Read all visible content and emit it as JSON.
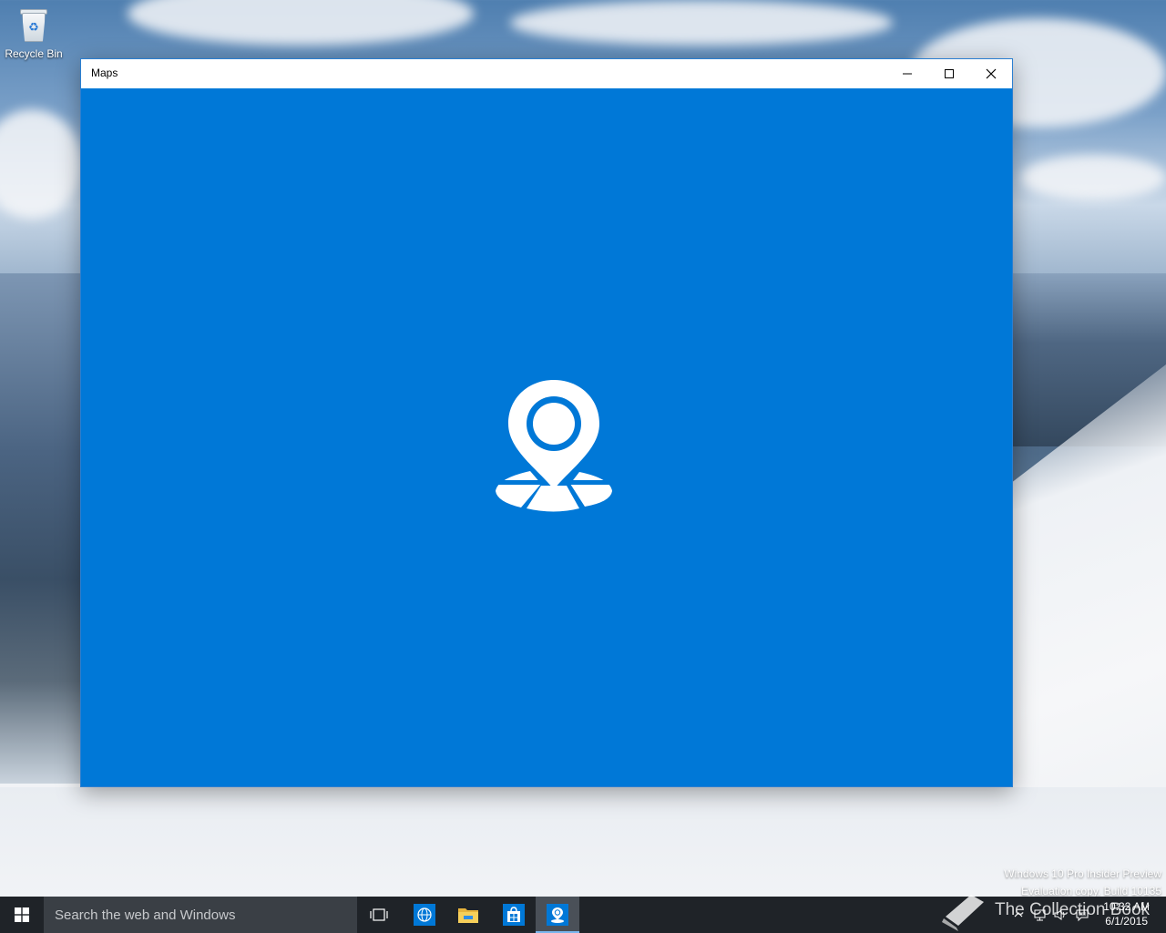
{
  "desktop": {
    "icons": [
      {
        "label": "Recycle Bin",
        "icon": "recycle-bin-icon"
      }
    ],
    "watermark": {
      "line1": "Windows 10 Pro Insider Preview",
      "line2": "Evaluation copy. Build 10135"
    }
  },
  "window": {
    "title": "Maps",
    "controls": {
      "minimize": "minimize-icon",
      "maximize": "maximize-icon",
      "close": "close-icon"
    },
    "splash_color": "#0078d7",
    "splash_icon": "maps-pin-icon"
  },
  "taskbar": {
    "search_placeholder": "Search the web and Windows",
    "pinned": [
      {
        "name": "task-view",
        "icon": "task-view-icon"
      },
      {
        "name": "edge",
        "icon": "globe-icon"
      },
      {
        "name": "file-explorer",
        "icon": "folder-icon"
      },
      {
        "name": "store",
        "icon": "store-icon"
      },
      {
        "name": "maps",
        "icon": "maps-icon",
        "active": true
      }
    ],
    "tray": {
      "time": "10:32 AM",
      "date": "6/1/2015"
    }
  },
  "overlay_logo": {
    "text": "The Collection Book"
  },
  "colors": {
    "accent": "#0078d7",
    "taskbar": "#1f2328",
    "search": "#3a3f45"
  }
}
